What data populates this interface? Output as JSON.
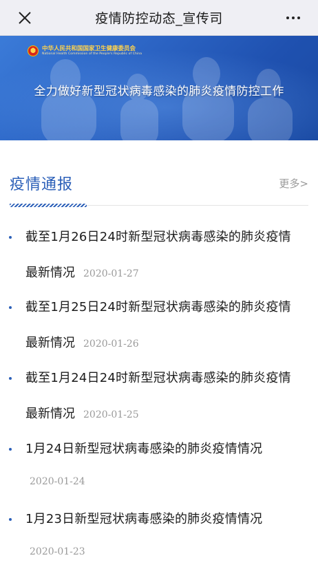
{
  "header": {
    "title": "疫情防控动态_宣传司",
    "close_icon": "close-icon",
    "more_icon": "more-dots-icon"
  },
  "banner": {
    "org_cn": "中华人民共和国国家卫生健康委员会",
    "org_en": "National Health Commission of the People's Republic of China",
    "slogan": "全力做好新型冠状病毒感染的肺炎疫情防控工作",
    "emblem_icon": "national-emblem-icon"
  },
  "section": {
    "title": "疫情通报",
    "more_label": "更多>"
  },
  "news": [
    {
      "title_line1": "截至1月26日24时新型冠状病毒感染的肺炎疫情",
      "title_line2": "最新情况",
      "date": "2020-01-27"
    },
    {
      "title_line1": "截至1月25日24时新型冠状病毒感染的肺炎疫情",
      "title_line2": "最新情况",
      "date": "2020-01-26"
    },
    {
      "title_line1": "截至1月24日24时新型冠状病毒感染的肺炎疫情",
      "title_line2": "最新情况",
      "date": "2020-01-25"
    },
    {
      "title_line1": "1月24日新型冠状病毒感染的肺炎疫情情况",
      "title_line2": "",
      "date": "2020-01-24"
    },
    {
      "title_line1": "1月23日新型冠状病毒感染的肺炎疫情情况",
      "title_line2": "",
      "date": "2020-01-23"
    }
  ],
  "colors": {
    "accent": "#2b5fb8",
    "muted": "#9a9a9a",
    "topbar_bg": "#efeff4",
    "banner_blue": "#2d66c6",
    "emblem_gold": "#ffd34d"
  }
}
